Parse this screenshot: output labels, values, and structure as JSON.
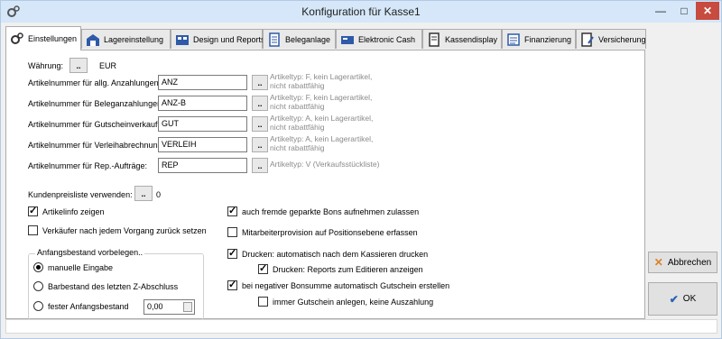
{
  "window": {
    "title": "Konfiguration für Kasse1"
  },
  "tabs": [
    {
      "label": "Einstellungen",
      "icon": "gears-icon",
      "active": true
    },
    {
      "label": "Lagereinstellung",
      "icon": "warehouse-icon"
    },
    {
      "label": "Design und Reports",
      "icon": "report-icon"
    },
    {
      "label": "Beleganlage",
      "icon": "document-icon"
    },
    {
      "label": "Elektronic Cash",
      "icon": "card-terminal-icon"
    },
    {
      "label": "Kassendisplay",
      "icon": "display-icon"
    },
    {
      "label": "Finanzierung",
      "icon": "finance-icon"
    },
    {
      "label": "Versicherung",
      "icon": "contract-icon"
    }
  ],
  "waehrung": {
    "label": "Währung:",
    "button": "..",
    "value": "EUR"
  },
  "articles": [
    {
      "label": "Artikelnummer für allg. Anzahlungen:",
      "value": "ANZ",
      "button": "..",
      "hint1": "Artikeltyp: F, kein Lagerartikel,",
      "hint2": "nicht rabattfähig"
    },
    {
      "label": "Artikelnummer für Beleganzahlungen:",
      "value": "ANZ-B",
      "button": "..",
      "hint1": "Artikeltyp: F, kein Lagerartikel,",
      "hint2": "nicht rabattfähig"
    },
    {
      "label": "Artikelnummer für Gutscheinverkauf:",
      "value": "GUT",
      "button": "..",
      "hint1": "Artikeltyp: A, kein Lagerartikel,",
      "hint2": "nicht rabattfähig"
    },
    {
      "label": "Artikelnummer für Verleihabrechnung:",
      "value": "VERLEIH",
      "button": "..",
      "hint1": "Artikeltyp: A, kein Lagerartikel,",
      "hint2": "nicht rabattfähig"
    },
    {
      "label": "Artikelnummer für Rep.-Aufträge:",
      "value": "REP",
      "button": "..",
      "hint1": "Artikeltyp: V (Verkaufsstückliste)",
      "hint2": ""
    }
  ],
  "kundenpreisliste": {
    "label": "Kundenpreisliste verwenden:",
    "button": "..",
    "value": "0"
  },
  "left_checks": [
    {
      "label": "Artikelinfo zeigen",
      "checked": true
    },
    {
      "label": "Verkäufer nach jedem Vorgang zurück setzen",
      "checked": false
    }
  ],
  "anfangsbestand": {
    "title": "Anfangsbestand vorbelegen..",
    "options": [
      {
        "label": "manuelle Eingabe",
        "checked": true
      },
      {
        "label": "Barbestand des letzten Z-Abschluss",
        "checked": false
      },
      {
        "label": "fester Anfangsbestand",
        "checked": false
      }
    ],
    "amount": "0,00"
  },
  "right_checks": [
    {
      "label": "auch fremde geparkte Bons aufnehmen zulassen",
      "checked": true
    },
    {
      "label": "Mitarbeiterprovision auf Positionsebene erfassen",
      "checked": false
    },
    {
      "label": "Drucken: automatisch nach dem Kassieren drucken",
      "checked": true
    },
    {
      "label": "Drucken: Reports zum Editieren anzeigen",
      "checked": true
    },
    {
      "label": "bei negativer Bonsumme automatisch Gutschein erstellen",
      "checked": true
    },
    {
      "label": "immer Gutschein anlegen, keine Auszahlung",
      "checked": false
    }
  ],
  "buttons": {
    "cancel": "Abbrechen",
    "ok": "OK"
  },
  "colors": {
    "titlebar": "#d5e7f8",
    "close": "#c74b3f",
    "cancel_icon": "#d9822b",
    "ok_icon": "#2a62b8"
  }
}
